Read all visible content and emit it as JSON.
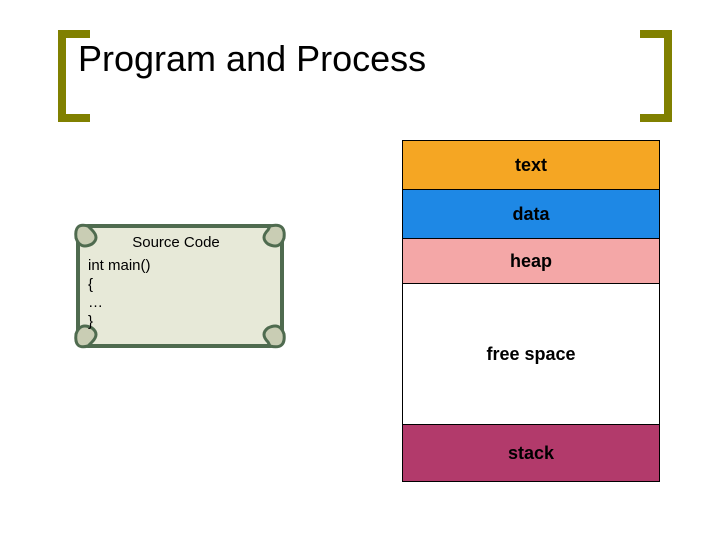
{
  "title": "Program and Process",
  "source": {
    "heading": "Source Code",
    "line1": "int main()",
    "line2": "{",
    "line3": "…",
    "line4": "}"
  },
  "segments": {
    "text": {
      "label": "text",
      "color": "#F5A623",
      "height": 50
    },
    "data": {
      "label": "data",
      "color": "#1E88E5",
      "height": 50
    },
    "heap": {
      "label": "heap",
      "color": "#F4A7A7",
      "height": 46
    },
    "free": {
      "label": "free space",
      "color": "#FFFFFF",
      "height": 142
    },
    "stack": {
      "label": "stack",
      "color": "#B23A6B",
      "height": 58
    }
  }
}
